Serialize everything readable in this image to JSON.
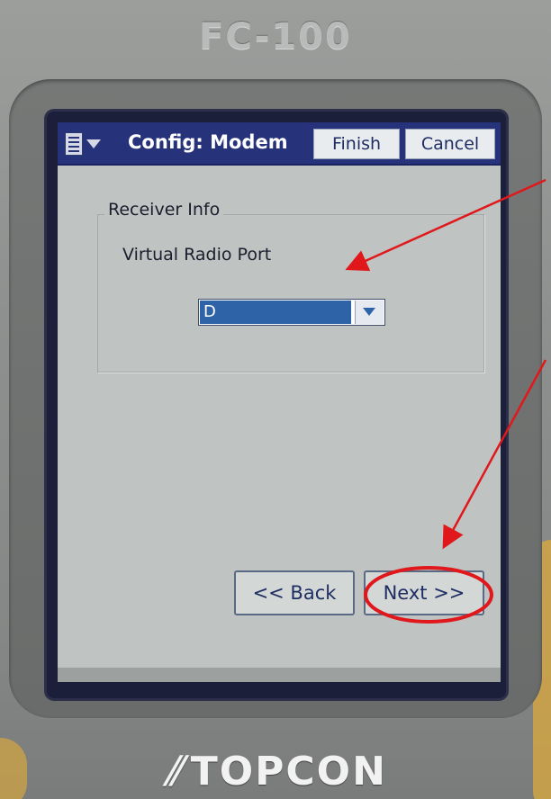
{
  "device": {
    "model": "FC-100",
    "brand": "TOPCON"
  },
  "titlebar": {
    "title": "Config: Modem",
    "finish_label": "Finish",
    "cancel_label": "Cancel"
  },
  "receiver_group": {
    "legend": "Receiver Info",
    "field_label": "Virtual Radio Port",
    "selected_value": "D"
  },
  "navigation": {
    "back_label": "<< Back",
    "next_label": "Next >>"
  },
  "colors": {
    "titlebar": "#26337a",
    "selection": "#2e63a7",
    "annotation": "#e0181c"
  }
}
